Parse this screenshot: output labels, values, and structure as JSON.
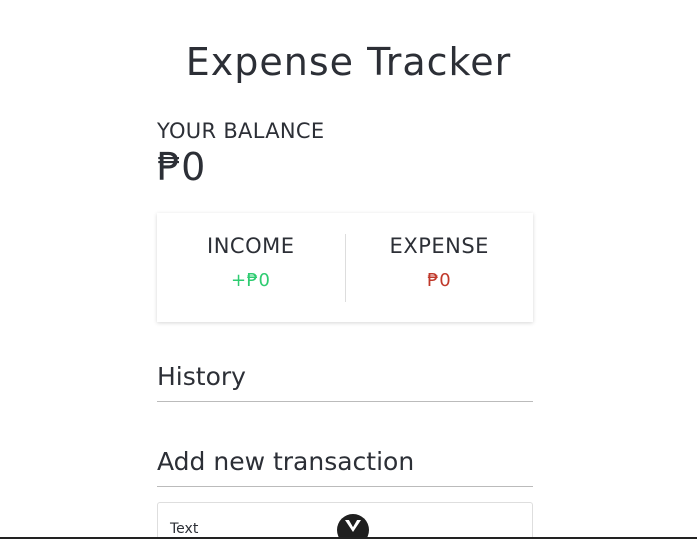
{
  "app": {
    "title": "Expense Tracker"
  },
  "balance": {
    "label": "YOUR BALANCE",
    "value": "₱0"
  },
  "summary": {
    "income_label": "INCOME",
    "income_value": "+₱0",
    "expense_label": "EXPENSE",
    "expense_value": "₱0",
    "income_color": "#2ecc71",
    "expense_color": "#c0392b"
  },
  "history": {
    "title": "History"
  },
  "add_transaction": {
    "title": "Add new transaction",
    "text_label": "Text"
  },
  "devtools": {
    "icon": "vue-devtools-icon"
  }
}
